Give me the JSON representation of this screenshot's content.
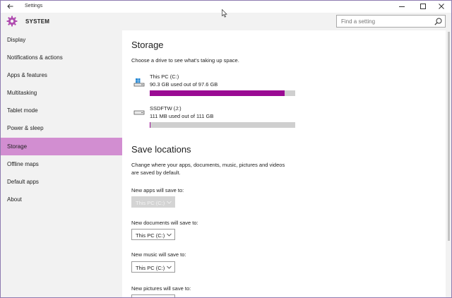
{
  "window": {
    "title": "Settings"
  },
  "header": {
    "section_title": "SYSTEM",
    "search_placeholder": "Find a setting"
  },
  "sidebar": {
    "items": [
      {
        "label": "Display"
      },
      {
        "label": "Notifications & actions"
      },
      {
        "label": "Apps & features"
      },
      {
        "label": "Multitasking"
      },
      {
        "label": "Tablet mode"
      },
      {
        "label": "Power & sleep"
      },
      {
        "label": "Storage",
        "active": true
      },
      {
        "label": "Offline maps"
      },
      {
        "label": "Default apps"
      },
      {
        "label": "About"
      }
    ]
  },
  "storage": {
    "heading": "Storage",
    "subtitle": "Choose a drive to see what's taking up space.",
    "drives": [
      {
        "name": "This PC (C:)",
        "usage": "90.3 GB used out of 97.6 GB",
        "used_fraction": 0.925,
        "icon": "windows-drive-icon"
      },
      {
        "name": "SSDFTW (J:)",
        "usage": "111 MB used out of 111 GB",
        "used_fraction": 0.001,
        "icon": "drive-icon"
      }
    ]
  },
  "save_locations": {
    "heading": "Save locations",
    "description_line1": "Change where your apps, documents, music, pictures and videos",
    "description_line2": "are saved by default.",
    "settings": [
      {
        "label": "New apps will save to:",
        "value": "This PC (C:)",
        "disabled": true
      },
      {
        "label": "New documents will save to:",
        "value": "This PC (C:)"
      },
      {
        "label": "New music will save to:",
        "value": "This PC (C:)"
      },
      {
        "label": "New pictures will save to:",
        "value": ""
      }
    ]
  },
  "colors": {
    "accent": "#9a0a93",
    "nav_active": "#d28ed1",
    "track": "#cfcfcf"
  }
}
